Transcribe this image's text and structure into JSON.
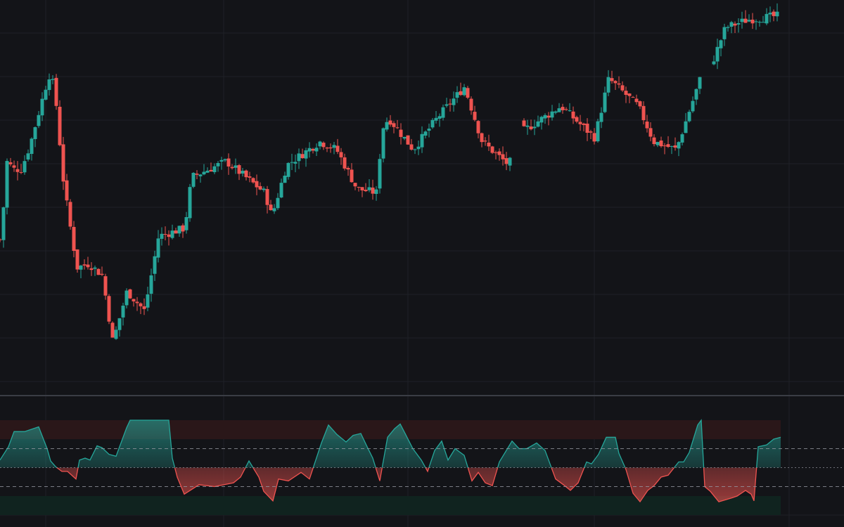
{
  "colors": {
    "background": "#131418",
    "grid": "#1f2127",
    "up": "#26a69a",
    "down": "#ef5350",
    "separator": "#3a3d45",
    "level_line": "#9598a1",
    "overbought_zone": "#2a1719",
    "oversold_zone": "#10231f"
  },
  "chart_data": [
    {
      "type": "candlestick",
      "title": "",
      "xlabel": "",
      "ylabel": "",
      "x_range": [
        0,
        221
      ],
      "ylim": [
        0,
        100
      ],
      "grid": true,
      "gaps": [
        [
          146,
          148
        ],
        [
          200,
          202
        ]
      ],
      "close_path": [
        [
          0,
          37
        ],
        [
          5,
          41
        ],
        [
          12,
          59
        ],
        [
          22,
          57
        ],
        [
          33,
          57
        ],
        [
          45,
          63
        ],
        [
          60,
          73
        ],
        [
          72,
          81
        ],
        [
          80,
          78
        ],
        [
          92,
          55
        ],
        [
          100,
          45
        ],
        [
          112,
          32
        ],
        [
          129,
          33
        ],
        [
          148,
          30
        ],
        [
          163,
          13
        ],
        [
          183,
          26
        ],
        [
          208,
          21
        ],
        [
          228,
          40
        ],
        [
          265,
          42
        ],
        [
          275,
          55
        ],
        [
          324,
          59
        ],
        [
          379,
          51
        ],
        [
          389,
          45
        ],
        [
          410,
          58
        ],
        [
          457,
          64
        ],
        [
          481,
          62
        ],
        [
          510,
          52
        ],
        [
          539,
          51
        ],
        [
          545,
          67
        ],
        [
          555,
          70
        ],
        [
          590,
          62
        ],
        [
          624,
          70
        ],
        [
          663,
          78
        ],
        [
          688,
          64
        ],
        [
          726,
          58
        ],
        [
          740,
          66
        ],
        [
          800,
          73
        ],
        [
          848,
          65
        ],
        [
          868,
          80
        ],
        [
          910,
          73
        ],
        [
          932,
          64
        ],
        [
          964,
          62
        ],
        [
          1000,
          81
        ],
        [
          1015,
          84
        ],
        [
          1034,
          93
        ],
        [
          1066,
          95
        ],
        [
          1110,
          96
        ]
      ]
    },
    {
      "type": "area",
      "title": "",
      "xlabel": "",
      "ylabel": "",
      "x_range": [
        0,
        221
      ],
      "ylim": [
        0,
        100
      ],
      "levels": {
        "upper": 70,
        "middle": 50,
        "lower": 30
      },
      "zones": [
        {
          "name": "overbought",
          "from": 80,
          "to": 100
        },
        {
          "name": "oversold",
          "from": 0,
          "to": 20
        }
      ],
      "value_path": [
        [
          0,
          58
        ],
        [
          12,
          72
        ],
        [
          20,
          88
        ],
        [
          35,
          88
        ],
        [
          55,
          93
        ],
        [
          67,
          70
        ],
        [
          72,
          57
        ],
        [
          79,
          51
        ],
        [
          88,
          46
        ],
        [
          96,
          46
        ],
        [
          108,
          38
        ],
        [
          113,
          58
        ],
        [
          121,
          60
        ],
        [
          128,
          58
        ],
        [
          138,
          73
        ],
        [
          145,
          71
        ],
        [
          155,
          64
        ],
        [
          165,
          62
        ],
        [
          180,
          92
        ],
        [
          185,
          100
        ],
        [
          190,
          100
        ],
        [
          240,
          100
        ],
        [
          245,
          60
        ],
        [
          252,
          40
        ],
        [
          262,
          22
        ],
        [
          283,
          32
        ],
        [
          305,
          30
        ],
        [
          332,
          34
        ],
        [
          342,
          40
        ],
        [
          354,
          57
        ],
        [
          368,
          40
        ],
        [
          375,
          25
        ],
        [
          388,
          15
        ],
        [
          396,
          38
        ],
        [
          410,
          36
        ],
        [
          428,
          45
        ],
        [
          440,
          38
        ],
        [
          457,
          76
        ],
        [
          467,
          95
        ],
        [
          479,
          85
        ],
        [
          492,
          77
        ],
        [
          502,
          84
        ],
        [
          513,
          86
        ],
        [
          522,
          72
        ],
        [
          530,
          60
        ],
        [
          540,
          36
        ],
        [
          551,
          82
        ],
        [
          561,
          91
        ],
        [
          569,
          96
        ],
        [
          576,
          86
        ],
        [
          587,
          70
        ],
        [
          599,
          58
        ],
        [
          608,
          46
        ],
        [
          618,
          68
        ],
        [
          628,
          78
        ],
        [
          637,
          58
        ],
        [
          647,
          70
        ],
        [
          660,
          63
        ],
        [
          671,
          36
        ],
        [
          680,
          45
        ],
        [
          690,
          34
        ],
        [
          700,
          31
        ],
        [
          710,
          56
        ],
        [
          728,
          78
        ],
        [
          738,
          70
        ],
        [
          749,
          70
        ],
        [
          763,
          76
        ],
        [
          775,
          68
        ],
        [
          790,
          38
        ],
        [
          801,
          32
        ],
        [
          811,
          26
        ],
        [
          822,
          34
        ],
        [
          834,
          56
        ],
        [
          841,
          54
        ],
        [
          851,
          64
        ],
        [
          862,
          82
        ],
        [
          875,
          82
        ],
        [
          880,
          65
        ],
        [
          890,
          48
        ],
        [
          900,
          23
        ],
        [
          910,
          14
        ],
        [
          921,
          26
        ],
        [
          930,
          31
        ],
        [
          940,
          40
        ],
        [
          950,
          42
        ],
        [
          965,
          56
        ],
        [
          972,
          56
        ],
        [
          980,
          66
        ],
        [
          992,
          95
        ],
        [
          997,
          100
        ],
        [
          1002,
          30
        ],
        [
          1010,
          25
        ],
        [
          1022,
          14
        ],
        [
          1040,
          18
        ],
        [
          1048,
          20
        ],
        [
          1060,
          26
        ],
        [
          1068,
          22
        ],
        [
          1072,
          15
        ],
        [
          1078,
          72
        ],
        [
          1090,
          74
        ],
        [
          1100,
          80
        ],
        [
          1110,
          82
        ]
      ]
    }
  ]
}
